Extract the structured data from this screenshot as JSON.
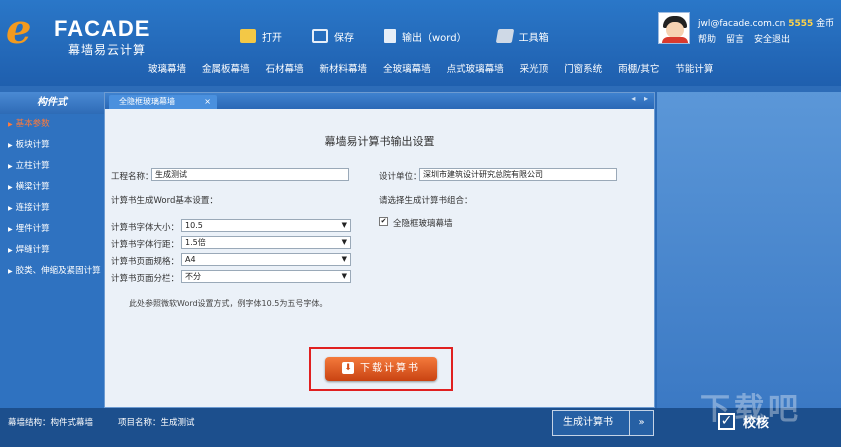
{
  "header": {
    "logo": {
      "letter": "e",
      "brand": "FACADE",
      "sub": "幕墙易云计算"
    },
    "toolbar": [
      {
        "label": "打开",
        "icon": "open-folder-icon"
      },
      {
        "label": "保存",
        "icon": "save-icon"
      },
      {
        "label": "输出（word）",
        "icon": "word-document-icon"
      },
      {
        "label": "工具箱",
        "icon": "toolbox-icon"
      }
    ],
    "user": {
      "email": "jwl@facade.com.cn",
      "coins": "5555",
      "coins_unit": "金币",
      "links": [
        "帮助",
        "留言",
        "安全退出"
      ]
    },
    "nav": [
      "玻璃幕墙",
      "金属板幕墙",
      "石材幕墙",
      "新材料幕墙",
      "全玻璃幕墙",
      "点式玻璃幕墙",
      "采光顶",
      "门窗系统",
      "雨棚/其它",
      "节能计算"
    ]
  },
  "sidebar": {
    "title": "构件式",
    "items": [
      {
        "label": "基本参数",
        "active": true
      },
      {
        "label": "板块计算",
        "active": false
      },
      {
        "label": "立柱计算",
        "active": false
      },
      {
        "label": "横梁计算",
        "active": false
      },
      {
        "label": "连接计算",
        "active": false
      },
      {
        "label": "埋件计算",
        "active": false
      },
      {
        "label": "焊缝计算",
        "active": false
      },
      {
        "label": "胶类、伸缩及紧固计算",
        "active": false
      }
    ]
  },
  "panel": {
    "tab": {
      "label": "全隐框玻璃幕墙",
      "close": "×"
    },
    "tab_arrows": [
      "◂",
      "▸"
    ],
    "title": "幕墙易计算书输出设置",
    "project_name_label": "工程名称：",
    "project_name_value": "生成测试",
    "design_unit_label": "设计单位：",
    "design_unit_value": "深圳市建筑设计研究总院有限公司",
    "word_settings_label": "计算书生成Word基本设置：",
    "combo_label": "请选择生成计算书组合：",
    "settings": [
      {
        "label": "计算书字体大小：",
        "value": "10.5"
      },
      {
        "label": "计算书字体行距：",
        "value": "1.5倍"
      },
      {
        "label": "计算书页面规格：",
        "value": "A4"
      },
      {
        "label": "计算书页面分栏：",
        "value": "不分"
      }
    ],
    "combo_option": {
      "label": "全隐框玻璃幕墙",
      "checked": true
    },
    "note": "此处参照微软Word设置方式，例字体10.5为五号字体。",
    "download_label": "下载计算书",
    "download_icon": "download-arrow-icon"
  },
  "bottom": {
    "structure": "幕墙结构：构件式幕墙",
    "project": "项目名称：生成测试",
    "generate_label": "生成计算书",
    "generate_arrow": "»",
    "check_label": "校核",
    "watermark": "下载吧"
  }
}
